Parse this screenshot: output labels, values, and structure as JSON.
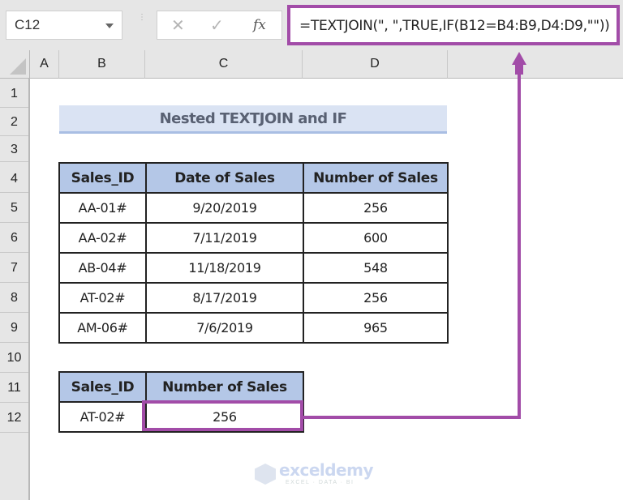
{
  "formula_bar": {
    "name_box": "C12",
    "cancel_icon": "✕",
    "enter_icon": "✓",
    "fx_label": "fx",
    "formula": "=TEXTJOIN(\", \",TRUE,IF(B12=B4:B9,D4:D9,\"\"))"
  },
  "columns": [
    "A",
    "B",
    "C",
    "D"
  ],
  "rows": [
    "1",
    "2",
    "3",
    "4",
    "5",
    "6",
    "7",
    "8",
    "9",
    "10",
    "11",
    "12"
  ],
  "title": "Nested TEXTJOIN and IF",
  "main_table": {
    "headers": [
      "Sales_ID",
      "Date of Sales",
      "Number of Sales"
    ],
    "rows": [
      [
        "AA-01#",
        "9/20/2019",
        "256"
      ],
      [
        "AA-02#",
        "7/11/2019",
        "600"
      ],
      [
        "AB-04#",
        "11/18/2019",
        "548"
      ],
      [
        "AT-02#",
        "8/17/2019",
        "256"
      ],
      [
        "AM-06#",
        "7/6/2019",
        "965"
      ]
    ]
  },
  "lookup_table": {
    "headers": [
      "Sales_ID",
      "Number of Sales"
    ],
    "lookup_id": "AT-02#",
    "result": "256"
  },
  "watermark": {
    "name": "exceldemy",
    "tagline": "EXCEL · DATA · BI"
  },
  "colors": {
    "highlight": "#a24ca8",
    "header_fill": "#b4c7e7",
    "title_fill": "#dae3f3"
  }
}
